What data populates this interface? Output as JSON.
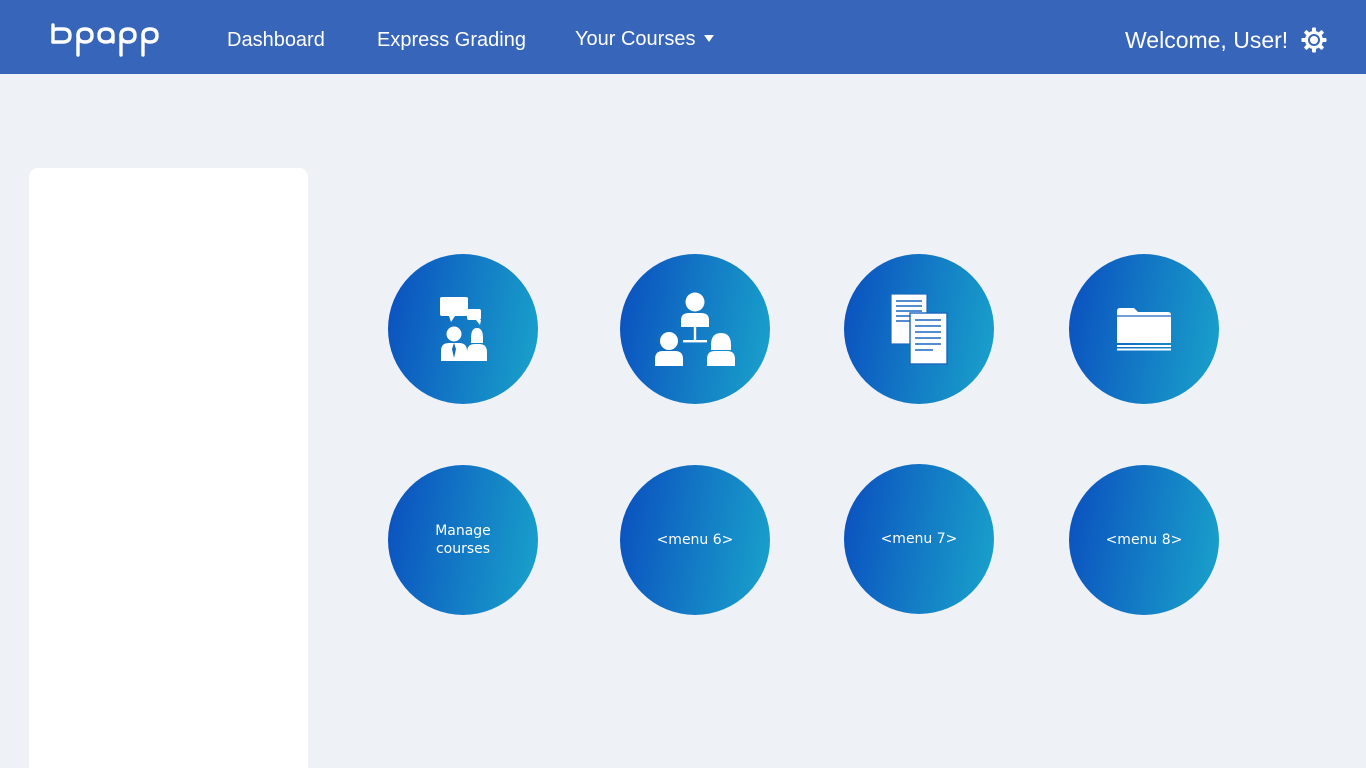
{
  "header": {
    "logo_text": "bpapp",
    "nav": {
      "dashboard": "Dashboard",
      "express_grading": "Express Grading",
      "your_courses": "Your Courses"
    },
    "welcome": "Welcome, User!",
    "settings_icon": "gear-icon",
    "background_color": "#3765ba"
  },
  "side_panel": {},
  "menu_tiles": [
    {
      "icon": "discussion-people-icon",
      "label": ""
    },
    {
      "icon": "team-hierarchy-icon",
      "label": ""
    },
    {
      "icon": "documents-icon",
      "label": ""
    },
    {
      "icon": "folder-icon",
      "label": ""
    },
    {
      "icon": "",
      "label": "Manage\ncourses"
    },
    {
      "icon": "",
      "label": "<menu 6>"
    },
    {
      "icon": "",
      "label": "<menu 7>"
    },
    {
      "icon": "",
      "label": "<menu 8>"
    }
  ],
  "colors": {
    "page_background": "#eef2f7",
    "tile_gradient_start": "#0a4ebf",
    "tile_gradient_end": "#19a4cb"
  }
}
